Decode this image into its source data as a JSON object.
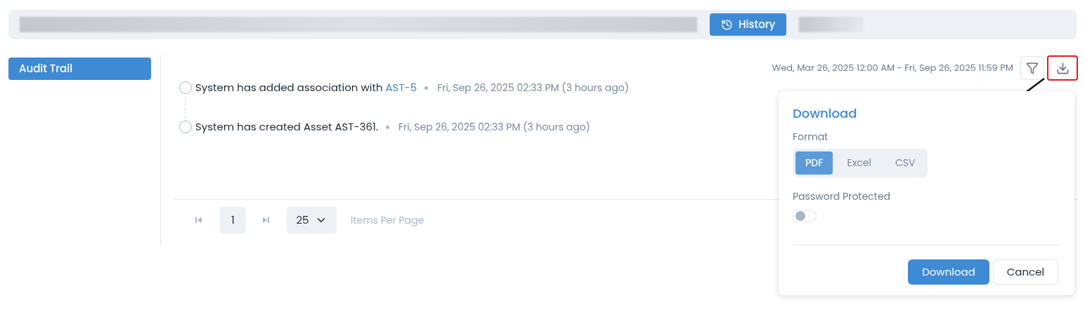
{
  "header": {
    "history_button": "History"
  },
  "sidebar": {
    "items": [
      {
        "label": "Audit Trail",
        "selected": true
      }
    ]
  },
  "toolbar": {
    "date_range": "Wed, Mar 26, 2025 12:00 AM - Fri, Sep 26, 2025 11:59 PM",
    "download_highlighted": true
  },
  "timeline": [
    {
      "text": "System has added association with",
      "link": "AST-5",
      "time": "Fri, Sep 26, 2025 02:33 PM (3 hours ago)"
    },
    {
      "text": "System has created Asset AST-361.",
      "time": "Fri, Sep 26, 2025 02:33 PM (3 hours ago)"
    }
  ],
  "pagination": {
    "page": "1",
    "page_size": "25",
    "page_size_label": "Items Per Page"
  },
  "download_popup": {
    "title": "Download",
    "format_label": "Format",
    "formats": [
      {
        "label": "PDF",
        "selected": true
      },
      {
        "label": "Excel",
        "selected": false
      },
      {
        "label": "CSV",
        "selected": false
      }
    ],
    "password_label": "Password Protected",
    "password_on": false,
    "buttons": [
      {
        "label": "Download",
        "kind": "primary"
      },
      {
        "label": "Cancel",
        "kind": "secondary"
      }
    ]
  }
}
